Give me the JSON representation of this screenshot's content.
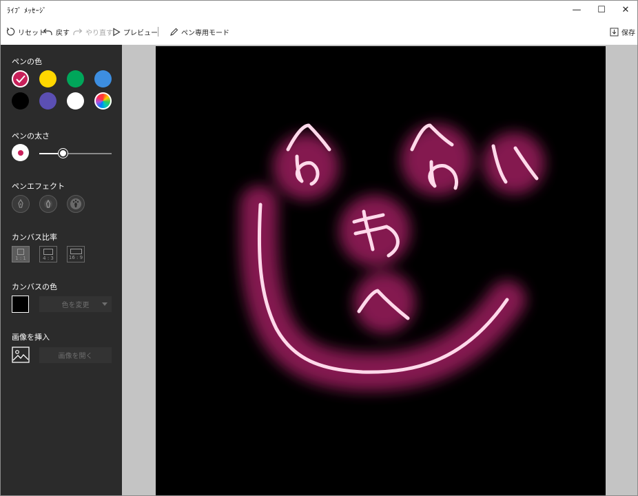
{
  "window": {
    "title": "ﾗｲﾌﾞ ﾒｯｾｰｼﾞ",
    "min_glyph": "—",
    "max_glyph": "☐",
    "close_glyph": "✕"
  },
  "toolbar": {
    "reset_label": "リセット",
    "undo_label": "戻す",
    "redo_label": "やり直す",
    "preview_label": "プレビュー",
    "pen_mode_label": "ペン専用モード",
    "save_label": "保存"
  },
  "sidebar": {
    "pen_color_label": "ペンの色",
    "pen_colors": [
      "#c8205a",
      "#ffd700",
      "#00a65a",
      "#3d8ee0",
      "#000000",
      "#5b4fb3",
      "#ffffff",
      "rainbow"
    ],
    "selected_color": "#c8205a",
    "pen_thickness_label": "ペンの太さ",
    "pen_thickness": 0.33,
    "pen_effect_label": "ペンエフェクト",
    "effects": [
      "ink-pen-icon",
      "glow-pen-icon",
      "rainbow-pen-icon"
    ],
    "canvas_ratio_label": "カンバス比率",
    "ratios": [
      "1 : 1",
      "4 : 3",
      "16 : 9"
    ],
    "selected_ratio": "1 : 1",
    "canvas_color_label": "カンバスの色",
    "canvas_color": "#000000",
    "change_color_label": "色を変更",
    "insert_image_label": "画像を挿入",
    "open_image_label": "画像を開く"
  },
  "canvas": {
    "background": "#000000",
    "ink_color": "#ffd9ea",
    "glow_color": "#b0206a",
    "drawing_text": [
      "へ",
      "の",
      "へ",
      "の",
      "も",
      "へ",
      "じ"
    ]
  }
}
